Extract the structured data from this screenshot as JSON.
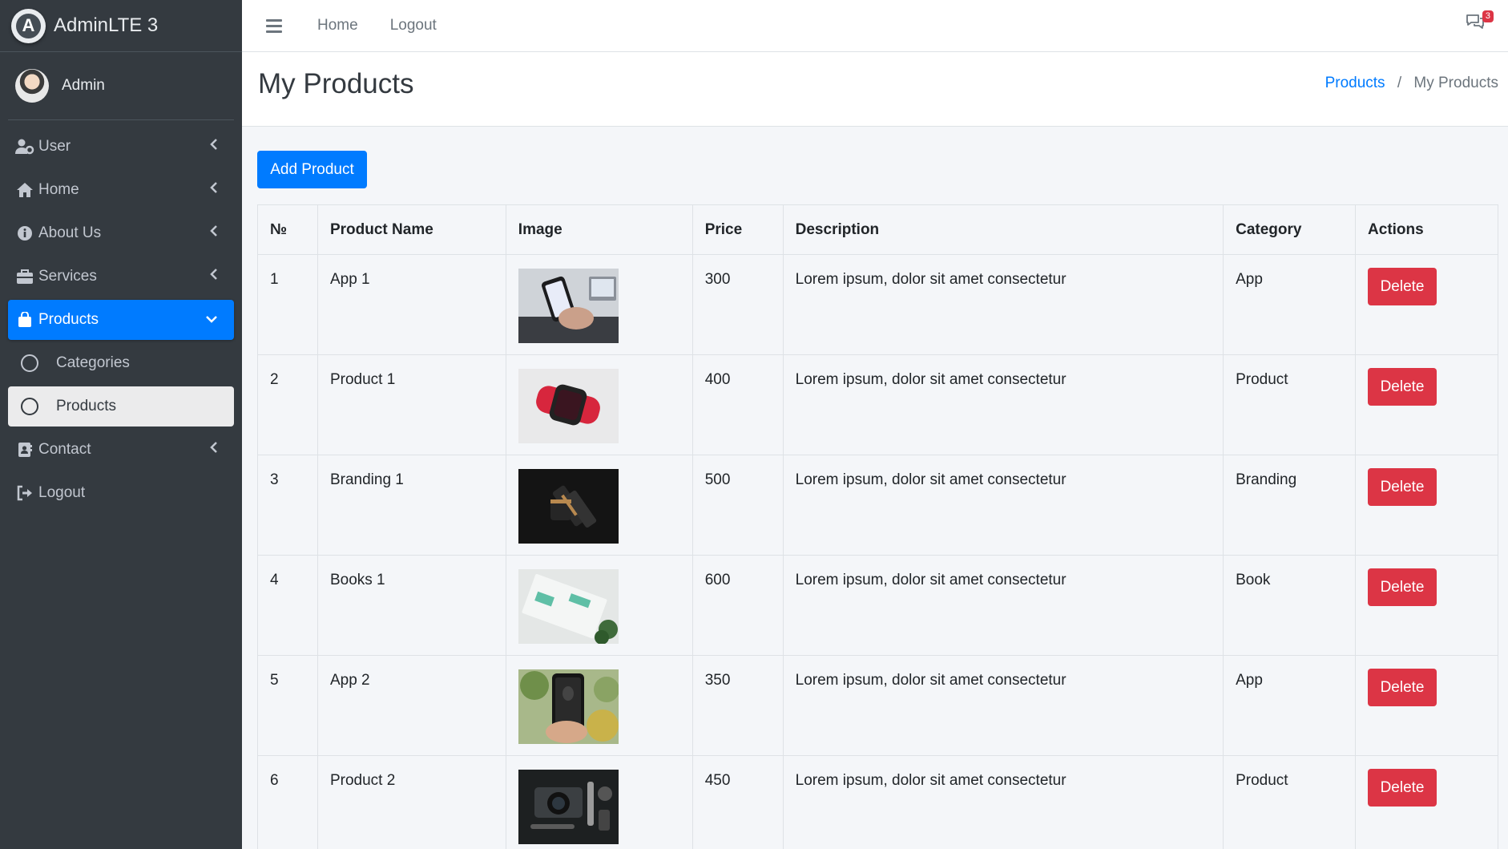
{
  "brand": {
    "name": "AdminLTE 3"
  },
  "user": {
    "name": "Admin"
  },
  "sidebar": {
    "items": [
      {
        "label": "User"
      },
      {
        "label": "Home"
      },
      {
        "label": "About Us"
      },
      {
        "label": "Services"
      },
      {
        "label": "Products"
      },
      {
        "label": "Categories"
      },
      {
        "label": "Products"
      },
      {
        "label": "Contact"
      },
      {
        "label": "Logout"
      }
    ]
  },
  "topbar": {
    "links": [
      "Home",
      "Logout"
    ],
    "notification_count": "3"
  },
  "header": {
    "title": "My Products",
    "breadcrumb": {
      "link": "Products",
      "separator": "/",
      "current": "My Products"
    }
  },
  "actions": {
    "add_label": "Add Product"
  },
  "table": {
    "columns": [
      "№",
      "Product Name",
      "Image",
      "Price",
      "Description",
      "Category",
      "Actions"
    ],
    "delete_label": "Delete",
    "rows": [
      {
        "no": "1",
        "name": "App 1",
        "price": "300",
        "description": "Lorem ipsum, dolor sit amet consectetur",
        "category": "App"
      },
      {
        "no": "2",
        "name": "Product 1",
        "price": "400",
        "description": "Lorem ipsum, dolor sit amet consectetur",
        "category": "Product"
      },
      {
        "no": "3",
        "name": "Branding 1",
        "price": "500",
        "description": "Lorem ipsum, dolor sit amet consectetur",
        "category": "Branding"
      },
      {
        "no": "4",
        "name": "Books 1",
        "price": "600",
        "description": "Lorem ipsum, dolor sit amet consectetur",
        "category": "Book"
      },
      {
        "no": "5",
        "name": "App 2",
        "price": "350",
        "description": "Lorem ipsum, dolor sit amet consectetur",
        "category": "App"
      },
      {
        "no": "6",
        "name": "Product 2",
        "price": "450",
        "description": "Lorem ipsum, dolor sit amet consectetur",
        "category": "Product"
      }
    ]
  },
  "colors": {
    "primary": "#007bff",
    "danger": "#dc3545",
    "sidebar": "#343a40"
  }
}
